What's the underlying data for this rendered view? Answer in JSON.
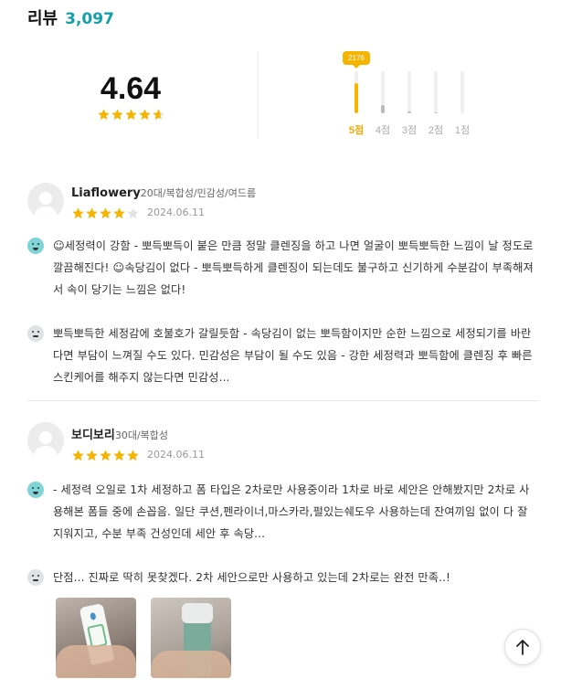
{
  "header": {
    "title": "리뷰",
    "count": "3,097"
  },
  "summary": {
    "score": "4.64",
    "star_color": "#f4b400",
    "distribution": [
      {
        "label": "5점",
        "fraction": 0.72,
        "bubble": "2176",
        "active": true
      },
      {
        "label": "4점",
        "fraction": 0.2,
        "active": false
      },
      {
        "label": "3점",
        "fraction": 0.05,
        "active": false
      },
      {
        "label": "2점",
        "fraction": 0.02,
        "active": false
      },
      {
        "label": "1점",
        "fraction": 0.01,
        "active": false
      }
    ]
  },
  "reviews": [
    {
      "name": "Liaflowery",
      "meta": "20대/복합성/민감성/여드름",
      "stars": 4,
      "date": "2024.06.11",
      "good": "☺세정력이 강함 - 뽀득뽀득이 붙은 만큼 정말 클렌징을 하고 나면 얼굴이 뽀득뽀득한 느낌이 날 정도로 깔끔해진다! ☺속당김이 없다 - 뽀득뽀득하게 클렌징이 되는데도 불구하고 신기하게 수분감이 부족해져서 속이 당기는 느낌은 없다!",
      "bad": "뽀득뽀득한 세정감에 호불호가 갈릴듯함 - 속당김이 없는 뽀득함이지만 순한 느낌으로 세정되기를 바란다면 부담이 느껴질 수도 있다. 민감성은 부담이 될 수도 있음 - 강한 세정력과 뽀득함에 클렌징 후 빠른 스킨케어를 해주지 않는다면 민감성..."
    },
    {
      "name": "보디보리",
      "meta": "30대/복합성",
      "stars": 5,
      "date": "2024.06.11",
      "good": "- 세정력 오일로 1차 세정하고 폼 타입은 2차로만 사용중이라 1차로 바로 세안은 안해봤지만 2차로 사용해본 폼들 중에 손꼽음. 일단 쿠션,펜라이너,마스카라,펄있는쉐도우 사용하는데 잔여끼임 없이 다 잘 지워지고, 수분 부족 건성인데 세안 후 속당...",
      "bad": "단점... 진짜로 딱히 못찾겠다. 2차 세안으로만 사용하고 있는데 2차로는 완전 만족..!"
    }
  ],
  "scroll_top_icon": "arrow-up-icon"
}
